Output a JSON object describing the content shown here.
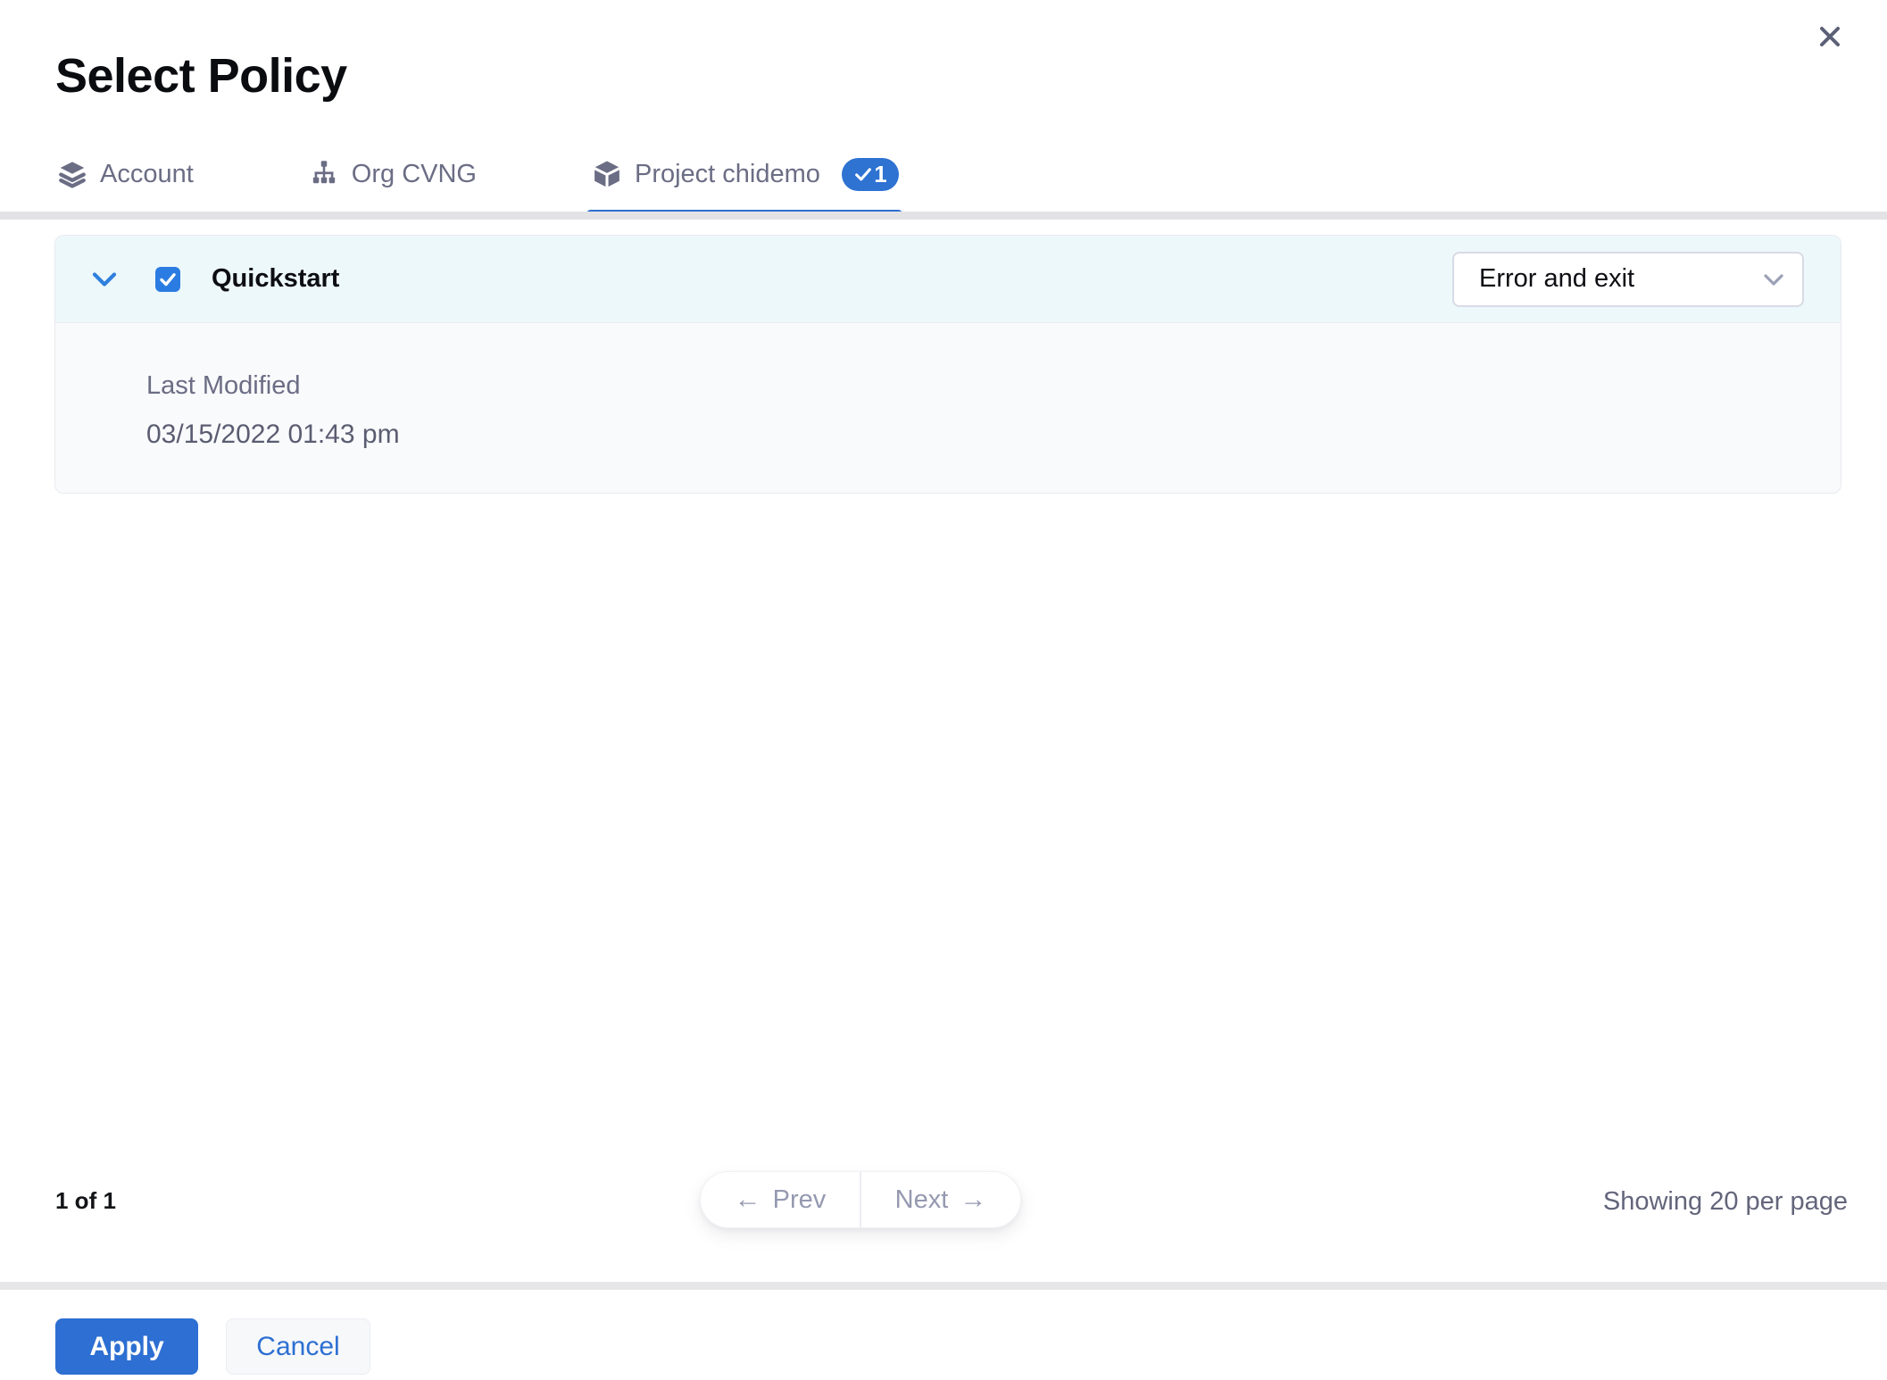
{
  "modal": {
    "title": "Select Policy"
  },
  "tabs": [
    {
      "label": "Account",
      "icon": "layers-icon",
      "active": false
    },
    {
      "label": "Org CVNG",
      "icon": "org-chart-icon",
      "active": false
    },
    {
      "label": "Project chidemo",
      "icon": "cube-icon",
      "active": true,
      "badge_count": "1"
    }
  ],
  "policy": {
    "name": "Quickstart",
    "checked": true,
    "action_select": {
      "value": "Error and exit"
    },
    "details": {
      "last_modified_label": "Last Modified",
      "last_modified_value": "03/15/2022 01:43 pm"
    }
  },
  "pagination": {
    "page_info": "1 of 1",
    "prev_label": "Prev",
    "next_label": "Next",
    "prev_arrow": "←",
    "next_arrow": "→",
    "showing_label": "Showing 20 per page"
  },
  "footer": {
    "apply_label": "Apply",
    "cancel_label": "Cancel"
  },
  "colors": {
    "primary_blue": "#2D6FD2",
    "checkbox_blue": "#2B7CE2",
    "badge_blue": "#2E72D2",
    "chevron_blue": "#2F80DD",
    "row_bg": "#EDF8FB",
    "detail_bg": "#F9FAFB",
    "tab_text": "#6B6D85",
    "muted_text": "#9599B0",
    "divider_gray": "#E3E3E5"
  }
}
